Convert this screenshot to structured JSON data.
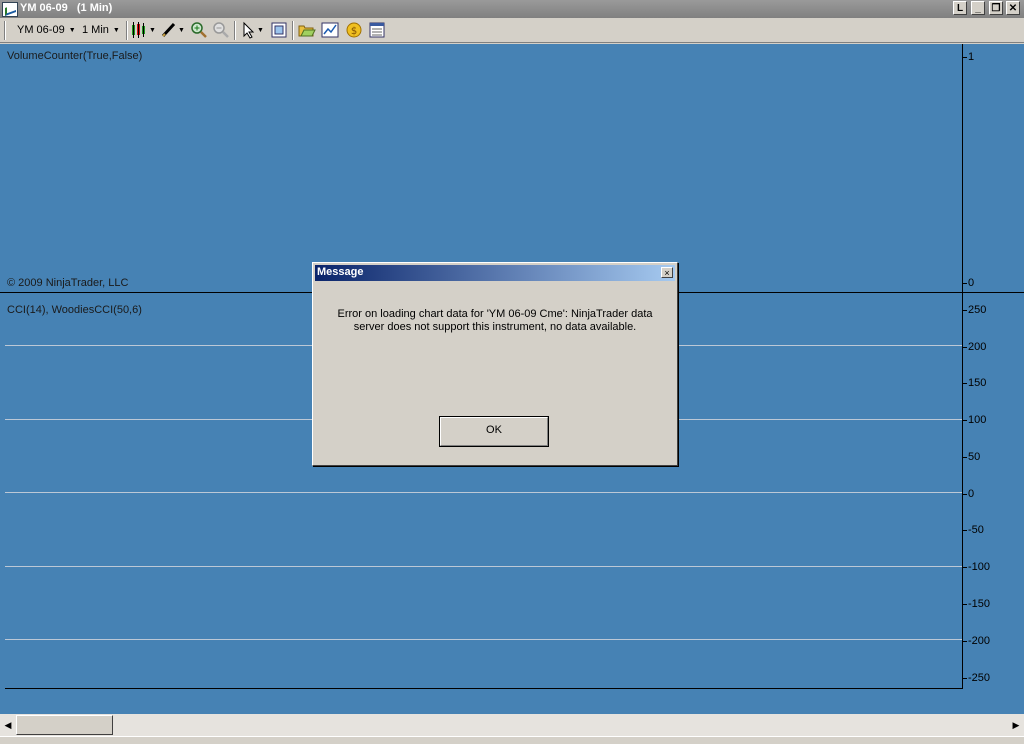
{
  "window": {
    "title": "YM 06-09   (1 Min)",
    "buttons": [
      "L",
      "▭",
      "🗗",
      "✕"
    ]
  },
  "toolbar": {
    "instrument": "YM 06-09",
    "interval": "1 Min"
  },
  "panels": [
    {
      "label": "VolumeCounter(True,False)",
      "copyright": "© 2009 NinjaTrader, LLC",
      "ticks": [
        "1",
        "0"
      ]
    },
    {
      "label": "CCI(14), WoodiesCCI(50,6)",
      "ticks": [
        "250",
        "200",
        "150",
        "100",
        "50",
        "0",
        "-50",
        "-100",
        "-150",
        "-200",
        "-250"
      ]
    }
  ],
  "dialog": {
    "title": "Message",
    "message": "Error on loading chart data for 'YM 06-09 Cme': NinjaTrader data server does not support this instrument, no data available.",
    "ok_label": "OK",
    "close_glyph": "×"
  },
  "scrollbar": {
    "left_arrow": "◀",
    "right_arrow": "▶"
  }
}
